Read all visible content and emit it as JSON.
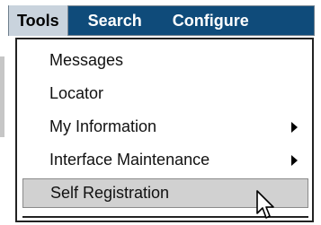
{
  "menubar": {
    "items": [
      {
        "label": "Tools",
        "active": true
      },
      {
        "label": "Search",
        "active": false
      },
      {
        "label": "Configure",
        "active": false
      }
    ],
    "background_color": "#0f4b7a",
    "active_background_color": "#c9d3dd"
  },
  "dropdown": {
    "items": [
      {
        "label": "Messages",
        "has_submenu": false,
        "highlighted": false
      },
      {
        "label": "Locator",
        "has_submenu": false,
        "highlighted": false
      },
      {
        "label": "My Information",
        "has_submenu": true,
        "highlighted": false
      },
      {
        "label": "Interface Maintenance",
        "has_submenu": true,
        "highlighted": false
      },
      {
        "label": "Self Registration",
        "has_submenu": false,
        "highlighted": true
      }
    ],
    "highlight_color": "#d1d1d1",
    "submenu_icon": "triangle-right-icon"
  },
  "cursor": {
    "icon": "mouse-pointer-icon"
  }
}
